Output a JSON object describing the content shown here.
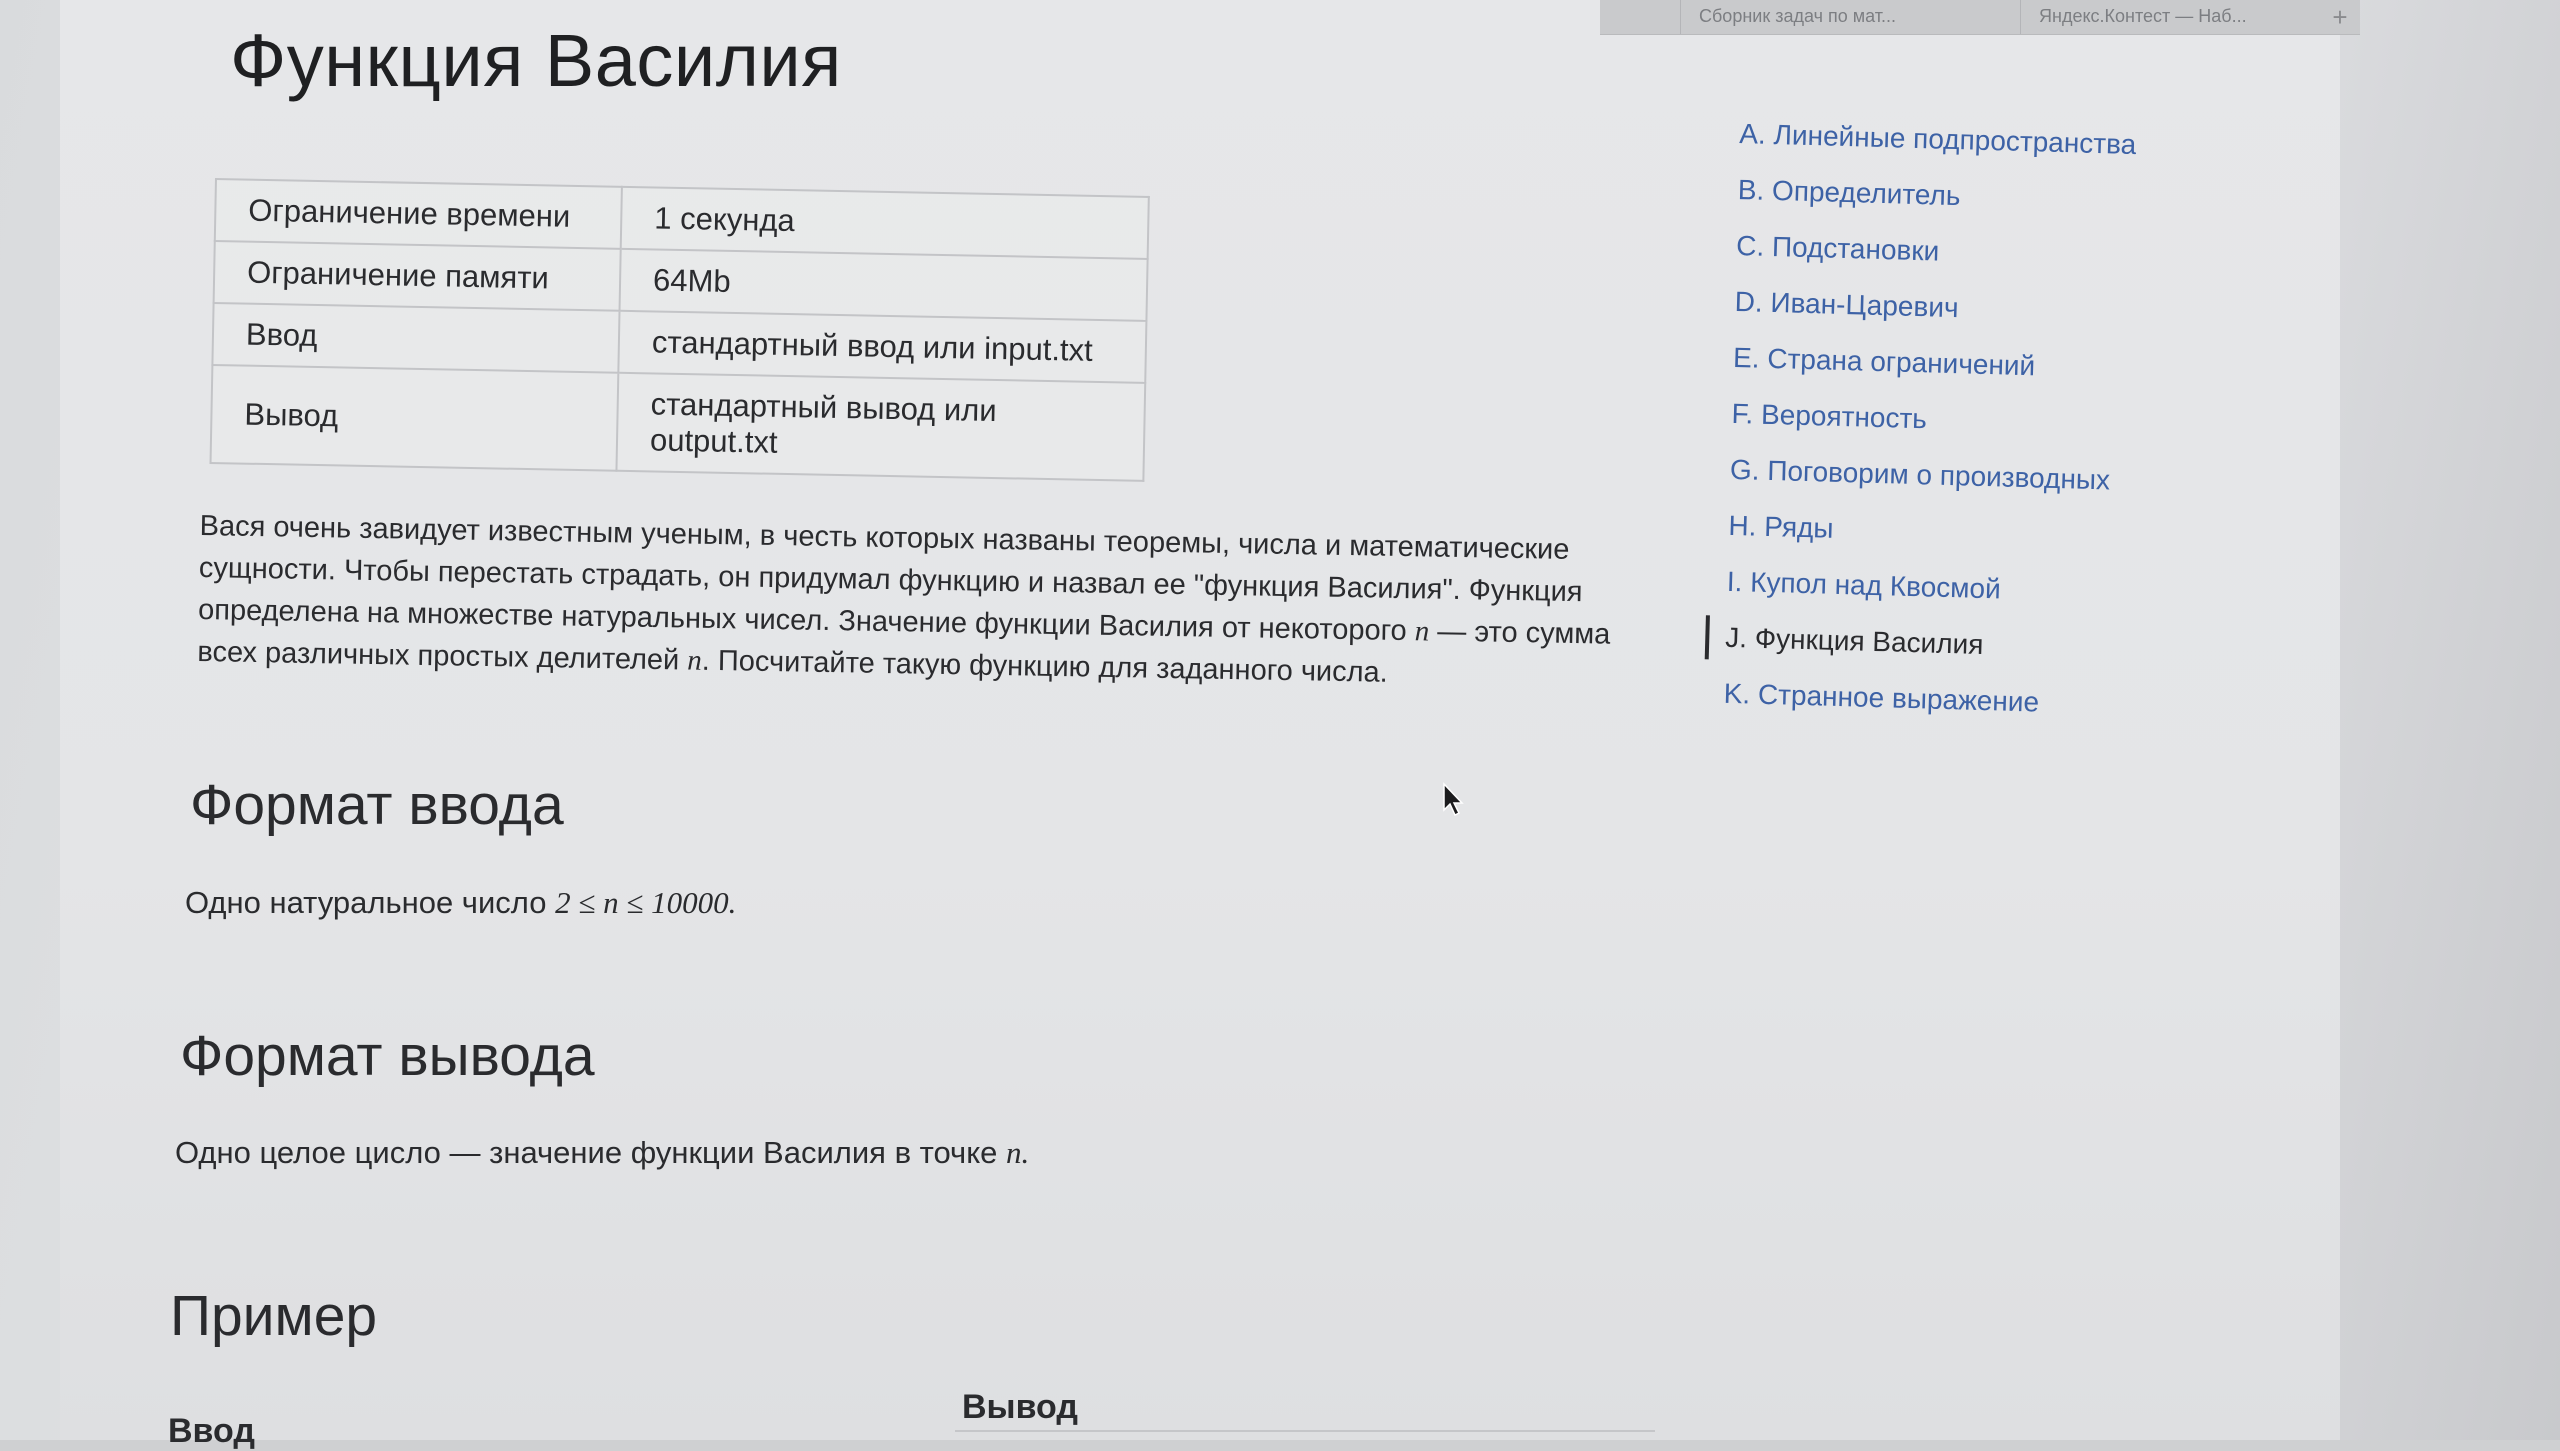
{
  "browser": {
    "tabs": [
      "Сборник задач по мат...",
      "Яндекс.Контест — Наб..."
    ],
    "new_tab_icon": "+"
  },
  "problem": {
    "title": "Функция Василия",
    "limits": [
      {
        "label": "Ограничение времени",
        "value": "1 секунда"
      },
      {
        "label": "Ограничение памяти",
        "value": "64Mb"
      },
      {
        "label": "Ввод",
        "value": "стандартный ввод или input.txt"
      },
      {
        "label": "Вывод",
        "value": "стандартный вывод или output.txt"
      }
    ],
    "statement": {
      "part1": "Вася очень завидует известным ученым, в честь которых названы теоремы, числа и математические сущности. Чтобы перестать страдать, он придумал функцию и назвал ее \"функция Василия\". Функция определена на множестве натуральных чисел. Значение функции Василия от некоторого ",
      "var1": "n",
      "part2": " — это сумма всех различных простых делителей ",
      "var2": "n",
      "part3": ". Посчитайте такую функцию для заданного числа."
    },
    "input_format": {
      "heading": "Формат ввода",
      "text": "Одно натуральное число ",
      "math": "2 ≤ n ≤ 10000."
    },
    "output_format": {
      "heading": "Формат вывода",
      "text": "Одно целое цисло — значение функции Василия в точке ",
      "math": "n."
    },
    "example": {
      "heading": "Пример",
      "input_label": "Ввод",
      "output_label": "Вывод"
    }
  },
  "nav": {
    "items": [
      {
        "label": "A. Линейные подпространства",
        "active": false
      },
      {
        "label": "B. Определитель",
        "active": false
      },
      {
        "label": "C. Подстановки",
        "active": false
      },
      {
        "label": "D. Иван-Царевич",
        "active": false
      },
      {
        "label": "E. Страна ограничений",
        "active": false
      },
      {
        "label": "F. Вероятность",
        "active": false
      },
      {
        "label": "G. Поговорим о производных",
        "active": false
      },
      {
        "label": "H. Ряды",
        "active": false
      },
      {
        "label": "I. Купол над Квосмой",
        "active": false
      },
      {
        "label": "J. Функция Василия",
        "active": true
      },
      {
        "label": "K. Странное выражение",
        "active": false
      }
    ]
  },
  "colors": {
    "link": "#3d62a6",
    "text": "#2a2b2e",
    "border": "#c3c4c7"
  }
}
